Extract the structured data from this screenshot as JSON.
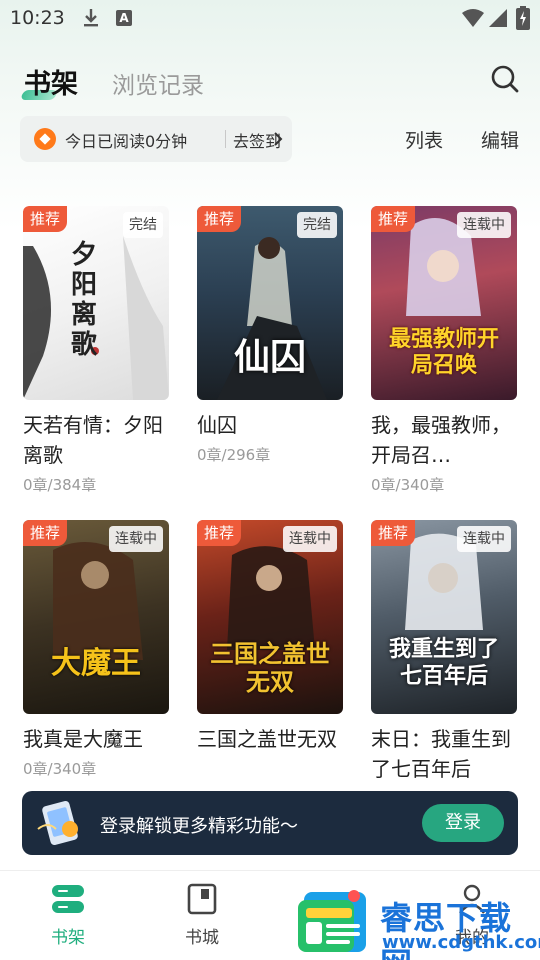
{
  "status_bar": {
    "time": "10:23"
  },
  "header": {
    "tab_shelf": "书架",
    "tab_history": "浏览记录"
  },
  "reading": {
    "today_text": "今日已阅读0分钟",
    "checkin_label": "去签到",
    "list_label": "列表",
    "edit_label": "编辑"
  },
  "books": [
    {
      "title": "天若有情：夕阳离歌",
      "chapters": "0章/384章",
      "tag": "推荐",
      "status": "完结",
      "cover_text": "夕阳离歌"
    },
    {
      "title": "仙囚",
      "chapters": "0章/296章",
      "tag": "推荐",
      "status": "完结",
      "cover_text": "仙囚"
    },
    {
      "title": "我，最强教师，开局召…",
      "chapters": "0章/340章",
      "tag": "推荐",
      "status": "连载中",
      "cover_text": "最强教师开局召唤"
    },
    {
      "title": "我真是大魔王",
      "chapters": "0章/340章",
      "tag": "推荐",
      "status": "连载中",
      "cover_text": "大魔王"
    },
    {
      "title": "三国之盖世无双",
      "chapters": "",
      "tag": "推荐",
      "status": "连载中",
      "cover_text": "三国之盖世无双"
    },
    {
      "title": "末日：我重生到了七百年后",
      "chapters": "",
      "tag": "推荐",
      "status": "连载中",
      "cover_text": "我重生到了七百年后"
    }
  ],
  "banner": {
    "text": "登录解锁更多精彩功能～",
    "login_label": "登录"
  },
  "nav": {
    "shelf": "书架",
    "city": "书城",
    "mine": "我的"
  },
  "watermark": {
    "name": "睿思下载网",
    "url": "www.cdgthk.com"
  },
  "colors": {
    "accent": "#1fae7e",
    "tag_red": "#ee5a3a",
    "banner_bg": "#1c2b3e"
  }
}
